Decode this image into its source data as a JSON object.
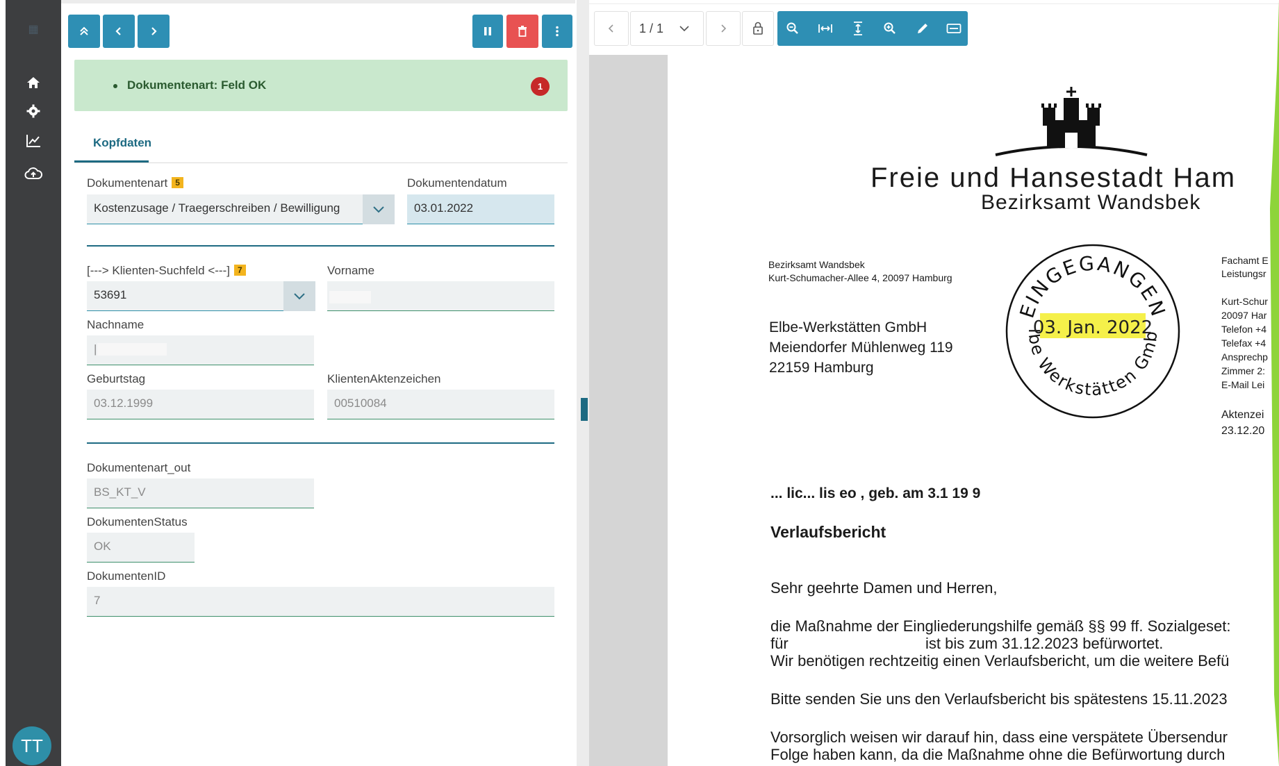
{
  "sidebar": {
    "logo_icon": "app-logo-icon",
    "nav": [
      {
        "icon": "home-icon"
      },
      {
        "icon": "gear-icon"
      },
      {
        "icon": "chart-icon"
      },
      {
        "icon": "cloud-upload-icon"
      }
    ],
    "avatar_initials": "TT"
  },
  "toolbar": {
    "buttons": [
      "double-chevron-up-icon",
      "chevron-left-icon",
      "chevron-right-icon"
    ],
    "actions": [
      "check-icon",
      "pause-icon",
      "trash-icon",
      "more-vert-icon"
    ]
  },
  "alert": {
    "message": "Dokumentenart: Feld OK",
    "count": "1"
  },
  "tabs": [
    {
      "label": "Kopfdaten"
    }
  ],
  "form": {
    "dokumentenart": {
      "label": "Dokumentenart",
      "badge": "5",
      "value": "Kostenzusage / Traegerschreiben / Bewilligung"
    },
    "dokumentendatum": {
      "label": "Dokumentendatum",
      "value": "03.01.2022"
    },
    "klienten_suchfeld": {
      "label": "[---> Klienten-Suchfeld <---]",
      "badge": "7",
      "value": "53691"
    },
    "vorname": {
      "label": "Vorname",
      "value": ""
    },
    "nachname": {
      "label": "Nachname",
      "value": "|"
    },
    "geburtstag": {
      "label": "Geburtstag",
      "value": "03.12.1999"
    },
    "klientenaktenzeichen": {
      "label": "KlientenAktenzeichen",
      "value": "00510084"
    },
    "dokumentenart_out": {
      "label": "Dokumentenart_out",
      "value": "BS_KT_V"
    },
    "dokumentenstatus": {
      "label": "DokumentenStatus",
      "value": "OK"
    },
    "dokumentenid": {
      "label": "DokumentenID",
      "value": "7"
    }
  },
  "viewer": {
    "page_indicator": "1 / 1",
    "tools": [
      "zoom-out-icon",
      "fit-width-icon",
      "fit-height-icon",
      "zoom-in-icon",
      "pen-icon",
      "form-icon"
    ],
    "lock_icon": "lock-icon"
  },
  "document": {
    "title": "Freie und Hansestadt Ham",
    "subtitle": "Bezirksamt Wandsbek",
    "sender_line1": "Bezirksamt Wandsbek",
    "sender_line2": "Kurt-Schumacher-Allee 4, 20097 Hamburg",
    "recipient": [
      "Elbe-Werkstätten GmbH",
      "Meiendorfer Mühlenweg 119",
      "22159 Hamburg"
    ],
    "stamp_top": "EINGEGANGEN",
    "stamp_date": "03. Jan. 2022",
    "stamp_bottom": "Elbe Werkstätten GmbH",
    "right_col": [
      "Fachamt E",
      "Leistungsr",
      "Kurt-Schur",
      "20097 Har",
      "Telefon +4",
      "Telefax +4",
      "Ansprechp",
      "Zimmer 2:",
      "E-Mail Lei",
      "Aktenzei",
      "23.12.20"
    ],
    "subject": "... lic... lis   eo  , geb. am  3.1  19 9",
    "heading": "Verlaufsbericht",
    "salutation": "Sehr geehrte Damen und Herren,",
    "para1_line1": "die Maßnahme der Eingliederungshilfe gemäß §§ 99 ff. Sozialgeset:",
    "para1_line2a": "für",
    "para1_line2b": "ist bis zum 31.12.2023 befürwortet.",
    "para1_line3": "Wir benötigen rechtzeitig einen Verlaufsbericht, um die weitere Befü",
    "para2": "Bitte senden Sie uns den Verlaufsbericht bis spätestens 15.11.2023",
    "para3_line1": "Vorsorglich weisen wir darauf hin, dass eine verspätete Übersendur",
    "para3_line2": "Folge haben kann, da die Maßnahme ohne die Befürwortung durch"
  },
  "colors": {
    "sidebar": "#3d3e40",
    "accent": "#2e8fb4",
    "danger": "#e85252",
    "alert_bg": "#c9e8cd",
    "stamp_highlight": "#f5f04a"
  }
}
